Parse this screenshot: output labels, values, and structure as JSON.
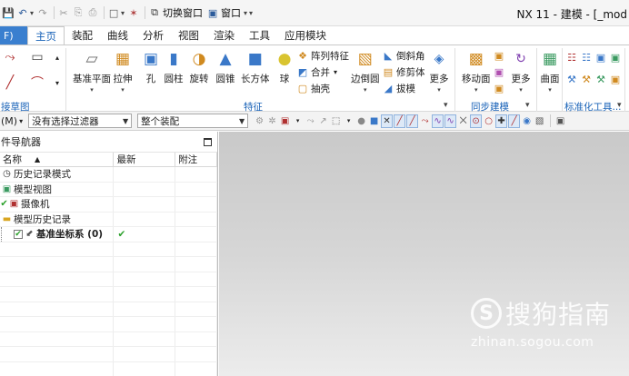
{
  "window": {
    "title": "NX 11 - 建模 - [_mod",
    "switch_window_label": "切换窗口",
    "window_menu_label": "窗口"
  },
  "tabs": {
    "file_label": "F)",
    "items": [
      "主页",
      "装配",
      "曲线",
      "分析",
      "视图",
      "渲染",
      "工具",
      "应用模块"
    ],
    "active_index": 0
  },
  "ribbon": {
    "groups": {
      "sketch_label": "接草图",
      "feature_label": "特征",
      "sync_label": "同步建模",
      "std_label": "标准化工具..."
    },
    "buttons": {
      "datum_plane": "基准平面",
      "extrude": "拉伸",
      "hole": "孔",
      "cylinder": "圆柱",
      "revolve": "旋转",
      "cone": "圆锥",
      "block": "长方体",
      "sphere": "球",
      "pattern": "阵列特征",
      "unite": "合并",
      "shell": "抽壳",
      "edge_blend": "边倒圆",
      "chamfer": "倒斜角",
      "trim_body": "修剪体",
      "draft": "拔模",
      "more1": "更多",
      "move_face": "移动面",
      "more2": "更多",
      "surface": "曲面"
    }
  },
  "selection_bar": {
    "menu_label": "(M)",
    "filter_value": "没有选择过滤器",
    "scope_value": "整个装配"
  },
  "navigator": {
    "title": "件导航器",
    "columns": {
      "name": "名称",
      "latest": "最新",
      "note": "附注"
    },
    "rows": [
      {
        "label": "历史记录模式",
        "icon": "clock-icon"
      },
      {
        "label": "模型视图",
        "icon": "model-views-icon"
      },
      {
        "label": "摄像机",
        "icon": "camera-icon"
      },
      {
        "label": "模型历史记录",
        "icon": "folder-icon"
      },
      {
        "label": "基准坐标系 (0)",
        "icon": "datum-csys-icon"
      }
    ]
  },
  "watermark": {
    "logo_char": "S",
    "text": "搜狗指南",
    "url": "zhinan.sogou.com"
  },
  "colors": {
    "accent": "#1a63b8",
    "file_tab": "#3a7fcf",
    "check_green": "#2aa02a"
  }
}
